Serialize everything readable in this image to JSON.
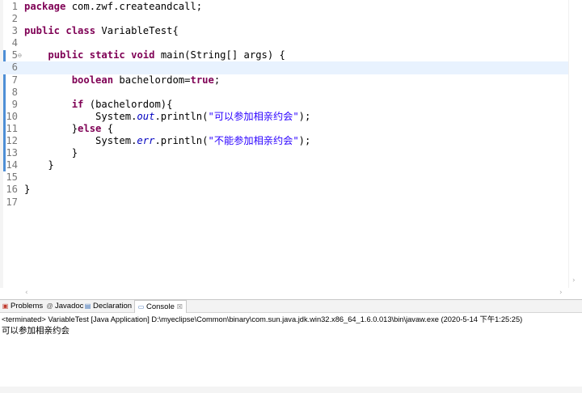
{
  "editor": {
    "lines": [
      {
        "n": "1",
        "tokens": [
          [
            "kw",
            "package"
          ],
          [
            "",
            "com.zwf.createandcall;"
          ]
        ]
      },
      {
        "n": "2",
        "tokens": []
      },
      {
        "n": "3",
        "tokens": [
          [
            "kw",
            "public"
          ],
          [
            "",
            ""
          ],
          [
            "kw",
            "class"
          ],
          [
            "",
            "VariableTest{"
          ]
        ]
      },
      {
        "n": "4",
        "tokens": []
      },
      {
        "n": "5",
        "fold": "⊖",
        "tokens": [
          [
            "",
            "    "
          ],
          [
            "kw",
            "public"
          ],
          [
            "kw",
            "static"
          ],
          [
            "kw",
            "void"
          ],
          [
            "",
            "main(String[] args) {"
          ]
        ]
      },
      {
        "n": "6",
        "current": true,
        "tokens": []
      },
      {
        "n": "7",
        "tokens": [
          [
            "",
            "        "
          ],
          [
            "kw",
            "boolean"
          ],
          [
            "",
            "bachelordom="
          ],
          [
            "kw",
            "true"
          ],
          [
            "",
            ";"
          ]
        ]
      },
      {
        "n": "8",
        "tokens": []
      },
      {
        "n": "9",
        "tokens": [
          [
            "",
            "        "
          ],
          [
            "kw",
            "if"
          ],
          [
            "",
            "(bachelordom){"
          ]
        ]
      },
      {
        "n": "10",
        "tokens": [
          [
            "",
            "            System."
          ],
          [
            "fld",
            "out"
          ],
          [
            "",
            ".println("
          ],
          [
            "str",
            "\"可以参加相亲约会\""
          ],
          [
            "",
            ");"
          ]
        ]
      },
      {
        "n": "11",
        "tokens": [
          [
            "",
            "        }"
          ],
          [
            "kw",
            "else"
          ],
          [
            "",
            "{"
          ]
        ]
      },
      {
        "n": "12",
        "tokens": [
          [
            "",
            "            System."
          ],
          [
            "fld",
            "err"
          ],
          [
            "",
            ".println("
          ],
          [
            "str",
            "\"不能参加相亲约会\""
          ],
          [
            "",
            ");"
          ]
        ]
      },
      {
        "n": "13",
        "tokens": [
          [
            "",
            "        }"
          ]
        ]
      },
      {
        "n": "14",
        "tokens": [
          [
            "",
            "    }"
          ]
        ]
      },
      {
        "n": "15",
        "tokens": []
      },
      {
        "n": "16",
        "tokens": [
          [
            "",
            "}"
          ]
        ]
      },
      {
        "n": "17",
        "tokens": []
      }
    ]
  },
  "panel": {
    "tabs": [
      {
        "icon": "problems-icon",
        "glyph": "▣",
        "label": "Problems",
        "color": "#c0392b"
      },
      {
        "icon": "javadoc-icon",
        "glyph": "@",
        "label": "Javadoc",
        "color": "#555"
      },
      {
        "icon": "declaration-icon",
        "glyph": "▤",
        "label": "Declaration",
        "color": "#3b6fb6"
      },
      {
        "icon": "console-icon",
        "glyph": "▭",
        "label": "Console",
        "color": "#3b6fb6",
        "close": "☒"
      }
    ],
    "status": "<terminated> VariableTest [Java Application] D:\\myeclipse\\Common\\binary\\com.sun.java.jdk.win32.x86_64_1.6.0.013\\bin\\javaw.exe (2020-5-14 下午1:25:25)",
    "output": "可以参加相亲约会"
  },
  "colors": {
    "keyword": "#7f0055",
    "field": "#0000c0",
    "string": "#2a00ff",
    "current_line": "#e8f2fe"
  }
}
